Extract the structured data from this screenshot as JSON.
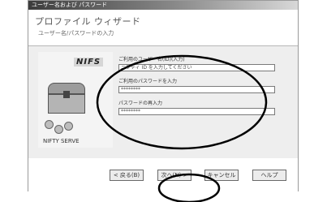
{
  "window": {
    "title": "ユーザー名および パスワード"
  },
  "header": {
    "title": "プロファイル ウィザード",
    "subtitle": "ユーザー名/パスワードの入力"
  },
  "logo": {
    "brand": "NIFS",
    "company": "NIFTY SERVE"
  },
  "form": {
    "fields": [
      {
        "label": "ご利用のユーザー名(ID)(入力)",
        "value": "ニフティ ID を入力してください"
      },
      {
        "label": "ご利用のパスワードを入力",
        "value": "********"
      },
      {
        "label": "パスワードの再入力",
        "value": "********"
      }
    ]
  },
  "buttons": {
    "back": "< 戻る(B)",
    "next": "次へ(N) >",
    "cancel": "キャンセル",
    "help": "ヘルプ"
  },
  "colors": {
    "annotation": "#000000",
    "field_bg": "#ffffff",
    "panel_bg": "#eeeeee"
  }
}
